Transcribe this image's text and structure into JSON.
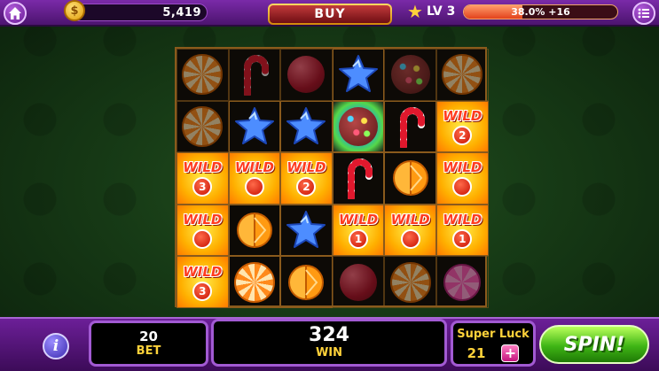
{
  "header": {
    "coins": "5,419",
    "coin_symbol": "$",
    "buy_label": "BUY",
    "level_label": "LV 3",
    "xp_percent": 38.0,
    "xp_text": "38.0% +16"
  },
  "reels": {
    "rows": [
      [
        {
          "s": "orange-swirl",
          "dim": true
        },
        {
          "s": "candy-cane",
          "dim": true
        },
        {
          "s": "red-lollipop",
          "dim": true
        },
        {
          "s": "blue-star",
          "dim": false
        },
        {
          "s": "sprinkle-donut",
          "dim": true
        },
        {
          "s": "orange-swirl",
          "dim": true
        }
      ],
      [
        {
          "s": "orange-swirl",
          "dim": true
        },
        {
          "s": "blue-star",
          "dim": false
        },
        {
          "s": "blue-star",
          "dim": false
        },
        {
          "s": "sprinkle-donut",
          "dim": false,
          "glow": true
        },
        {
          "s": "candy-cane",
          "dim": false
        },
        {
          "s": "wild",
          "mult": "2"
        }
      ],
      [
        {
          "s": "wild",
          "mult": "3"
        },
        {
          "s": "wild",
          "mult": ""
        },
        {
          "s": "wild",
          "mult": "2"
        },
        {
          "s": "candy-cane",
          "dim": false
        },
        {
          "s": "orange-slice",
          "dim": false
        },
        {
          "s": "wild",
          "mult": ""
        }
      ],
      [
        {
          "s": "wild",
          "mult": ""
        },
        {
          "s": "orange-slice",
          "dim": false
        },
        {
          "s": "blue-star",
          "dim": false
        },
        {
          "s": "wild",
          "mult": "1"
        },
        {
          "s": "wild",
          "mult": ""
        },
        {
          "s": "wild",
          "mult": "1"
        }
      ],
      [
        {
          "s": "wild",
          "mult": "3"
        },
        {
          "s": "orange-swirl",
          "dim": false
        },
        {
          "s": "orange-slice",
          "dim": false
        },
        {
          "s": "red-lollipop",
          "dim": true
        },
        {
          "s": "orange-swirl",
          "dim": true
        },
        {
          "s": "pink-swirl",
          "dim": true
        }
      ]
    ],
    "wild_label": "WILD"
  },
  "footer": {
    "bet_value": "20",
    "bet_label": "BET",
    "win_value": "324",
    "win_label": "WIN",
    "luck_title": "Super Luck",
    "luck_value": "21",
    "plus_label": "+",
    "spin_label": "SPIN!",
    "info_label": "i"
  }
}
